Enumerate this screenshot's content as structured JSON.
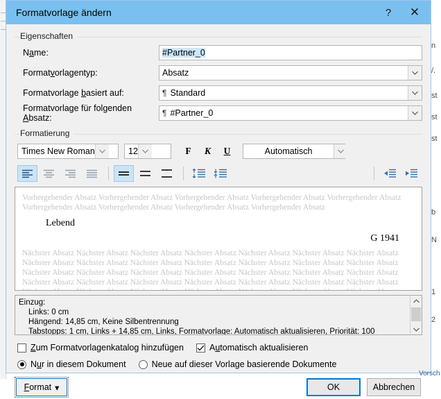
{
  "dialog": {
    "title": "Formatvorlage ändern",
    "help_label": "?",
    "close_label": "✕"
  },
  "properties": {
    "group_label": "Eigenschaften",
    "fields": [
      {
        "label_pre": "N",
        "label_accel": "a",
        "label_post": "me:",
        "label": "Name:",
        "value": "#Partner_0",
        "type": "text"
      },
      {
        "label": "Formatvorlagentyp:",
        "value": "Absatz",
        "type": "combo"
      },
      {
        "label": "Formatvorlage basiert auf:",
        "value": "Standard",
        "type": "combo",
        "glyph": "¶"
      },
      {
        "label": "Formatvorlage für folgenden Absatz:",
        "value": "#Partner_0",
        "type": "combo",
        "glyph": "¶"
      }
    ]
  },
  "formatting": {
    "group_label": "Formatierung",
    "font_name": "Times New Roman",
    "font_size": "12",
    "bold_label": "F",
    "italic_label": "K",
    "underline_label": "U",
    "font_color": "Automatisch",
    "align_buttons": [
      {
        "name": "align-left",
        "selected": true
      },
      {
        "name": "align-center",
        "selected": false
      },
      {
        "name": "align-right",
        "selected": false
      },
      {
        "name": "align-justify",
        "selected": false
      }
    ],
    "linespacing_buttons": [
      {
        "name": "line-spacing-single",
        "selected": true
      },
      {
        "name": "line-spacing-1_5",
        "selected": false
      },
      {
        "name": "line-spacing-double",
        "selected": false
      }
    ],
    "spacing_buttons": [
      {
        "name": "spacing-before-decrease",
        "selected": false
      },
      {
        "name": "spacing-after-increase",
        "selected": false
      }
    ],
    "indent_buttons": [
      {
        "name": "indent-decrease",
        "selected": false
      },
      {
        "name": "indent-increase",
        "selected": false
      }
    ]
  },
  "preview": {
    "before_text": "Vorhergehender Absatz Vorhergehender Absatz Vorhergehender Absatz Vorhergehender Absatz Vorhergehender Absatz Vorhergehender Absatz Vorhergehender Absatz Vorhergehender Absatz Vorhergehender Absatz",
    "sample_line1": "Lebend",
    "sample_line2": "G 1941",
    "after_text": "Nächster Absatz Nächster Absatz Nächster Absatz Nächster Absatz Nächster Absatz Nächster Absatz Nächster Absatz Nächster Absatz Nächster Absatz Nächster Absatz Nächster Absatz Nächster Absatz Nächster Absatz Nächster Absatz Nächster Absatz Nächster Absatz Nächster Absatz Nächster Absatz Nächster Absatz Nächster Absatz Nächster Absatz Nächster Absatz Nächster Absatz Nächster Absatz Nächster Absatz Nächster Absatz Nächster Absatz Nächster Absatz Nächster Absatz Nächster Absatz Nächster Absatz Nächster Absatz Nächster Absatz Nächster Absatz Nächster Absatz Nächster Absatz Nächster Absatz Nächster Absatz"
  },
  "description": {
    "line1": "Einzug:",
    "line2": "Links:  0 cm",
    "line3": "Hängend:  14,85 cm, Keine Silbentrennung",
    "line4": "Tabstopps:  1 cm, Links +  14,85 cm, Links, Formatvorlage: Automatisch aktualisieren, Priorität: 100"
  },
  "options": {
    "add_to_gallery": {
      "label": "Zum Formatvorlagenkatalog hinzufügen",
      "checked": false
    },
    "auto_update": {
      "label": "Automatisch aktualisieren",
      "checked": true
    },
    "this_document": {
      "label": "Nur in diesem Dokument",
      "selected": true
    },
    "new_documents": {
      "label": "Neue auf dieser Vorlage basierende Dokumente",
      "selected": false
    }
  },
  "footer": {
    "format_label": "Format",
    "format_caret": "▾",
    "ok_label": "OK",
    "cancel_label": "Abbrechen"
  },
  "background": {
    "right_fragments": [
      "n",
      "/.",
      "st",
      "st",
      "st",
      "b",
      "N",
      "1",
      "2"
    ],
    "bottom_right": "Vorschau a"
  },
  "colors": {
    "titlebar": "#79c0f0",
    "dialog_bg": "#f0f0f0",
    "accent": "#0078d7",
    "selection": "#cde6f7",
    "toolbar_on": "#cce4f7",
    "ghost_text": "#c6c6c6"
  }
}
